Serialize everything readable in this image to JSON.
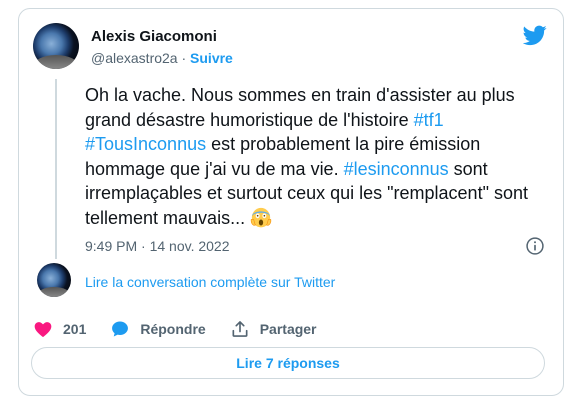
{
  "author": {
    "name": "Alexis Giacomoni",
    "handle": "@alexastro2a",
    "separator": "·",
    "follow_label": "Suivre"
  },
  "tweet": {
    "segments": [
      {
        "text": "Oh la vache. Nous sommes en train d'assister au plus grand désastre humoristique de l'histoire ",
        "type": "text"
      },
      {
        "text": "#tf1",
        "type": "hashtag"
      },
      {
        "text": " ",
        "type": "text"
      },
      {
        "text": "#TousInconnus",
        "type": "hashtag"
      },
      {
        "text": " est probablement la pire émission hommage que j'ai vu de ma vie. ",
        "type": "text"
      },
      {
        "text": "#lesinconnus",
        "type": "hashtag"
      },
      {
        "text": " sont irremplaçables et surtout ceux qui les \"remplacent\" sont tellement mauvais... ",
        "type": "text"
      }
    ],
    "emoji": "face-screaming-in-fear",
    "timestamp": "9:49 PM · 14 nov. 2022"
  },
  "thread": {
    "read_conversation_label": "Lire la conversation complète sur Twitter"
  },
  "actions": {
    "like_count": "201",
    "reply_label": "Répondre",
    "share_label": "Partager"
  },
  "replies_button_label": "Lire 7 réponses",
  "colors": {
    "accent": "#1d9bf0",
    "like": "#f91880",
    "secondary_text": "#536471",
    "border": "#cfd9de"
  },
  "icons": {
    "brand": "twitter-bird-icon",
    "info": "info-icon",
    "like": "heart-icon",
    "reply": "speech-bubble-icon",
    "share": "share-icon"
  }
}
